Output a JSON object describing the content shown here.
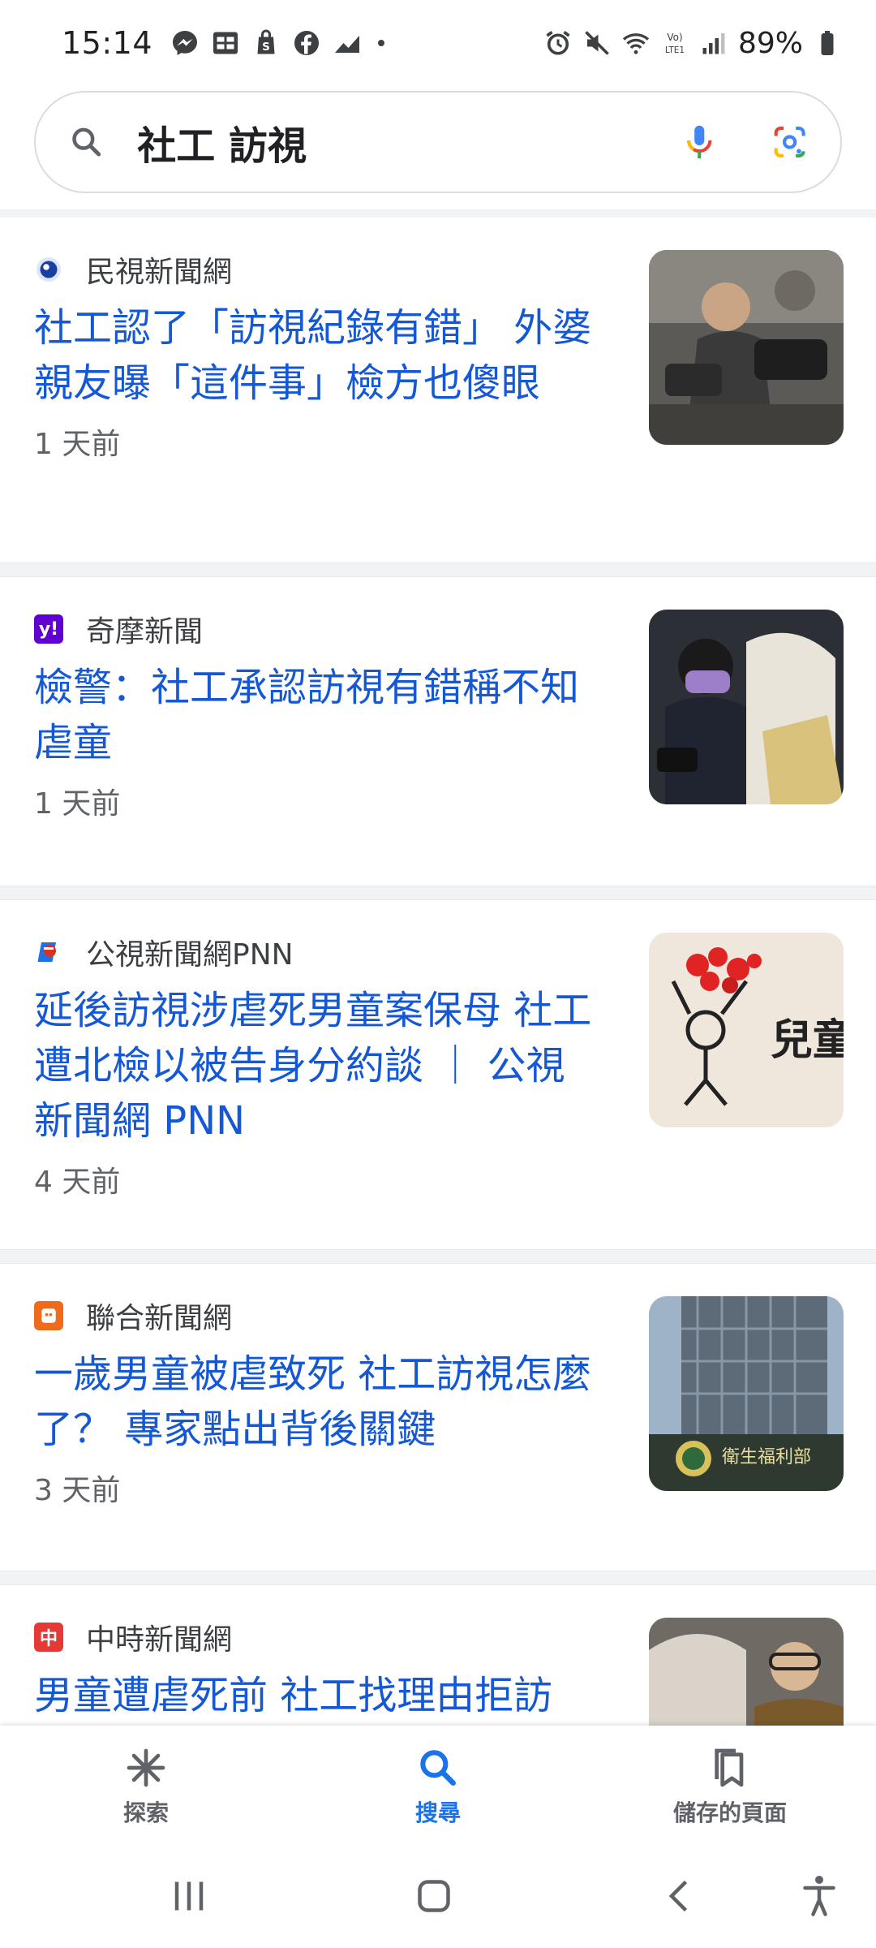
{
  "status_bar": {
    "time": "15:14",
    "battery": "89%",
    "left_icons": [
      "messenger-icon",
      "mi-icon",
      "shopping-bag-icon",
      "facebook-icon",
      "chart-icon"
    ],
    "right_icons": [
      "alarm-icon",
      "mute-icon",
      "wifi-icon",
      "volte-icon",
      "signal-icon",
      "battery-icon"
    ]
  },
  "search": {
    "query": "社工 訪視"
  },
  "results": [
    {
      "source": "民視新聞網",
      "headline": "社工認了「訪視紀錄有錯」 外婆親友曝「這件事」檢方也傻眼",
      "time": "1 天前",
      "favicon_color": "#1b3fa0"
    },
    {
      "source": "奇摩新聞",
      "headline": "檢警：社工承認訪視有錯稱不知虐童",
      "time": "1 天前",
      "favicon_color": "#6001d2"
    },
    {
      "source": "公視新聞網PNN",
      "headline": "延後訪視涉虐死男童案保母 社工遭北檢以被告身分約談 ｜ 公視新聞網 PNN",
      "time": "4 天前",
      "favicon_color": "#d93025"
    },
    {
      "source": "聯合新聞網",
      "headline": "一歲男童被虐致死 社工訪視怎麼了？ 專家點出背後關鍵",
      "time": "3 天前",
      "favicon_color": "#f06a1c"
    },
    {
      "source": "中時新聞網",
      "headline": "男童遭虐死前 社工找理由拒訪視！保母惹哭改訂「客好寶",
      "time": "",
      "favicon_color": "#e53935"
    }
  ],
  "bottom_nav": {
    "items": [
      {
        "label": "探索",
        "icon": "asterisk-icon"
      },
      {
        "label": "搜尋",
        "icon": "search-icon"
      },
      {
        "label": "儲存的頁面",
        "icon": "bookmarks-icon"
      }
    ],
    "active_index": 1,
    "active_color": "#1a73e8"
  },
  "system_nav": [
    "recents-button",
    "home-button",
    "back-button",
    "accessibility-button"
  ]
}
